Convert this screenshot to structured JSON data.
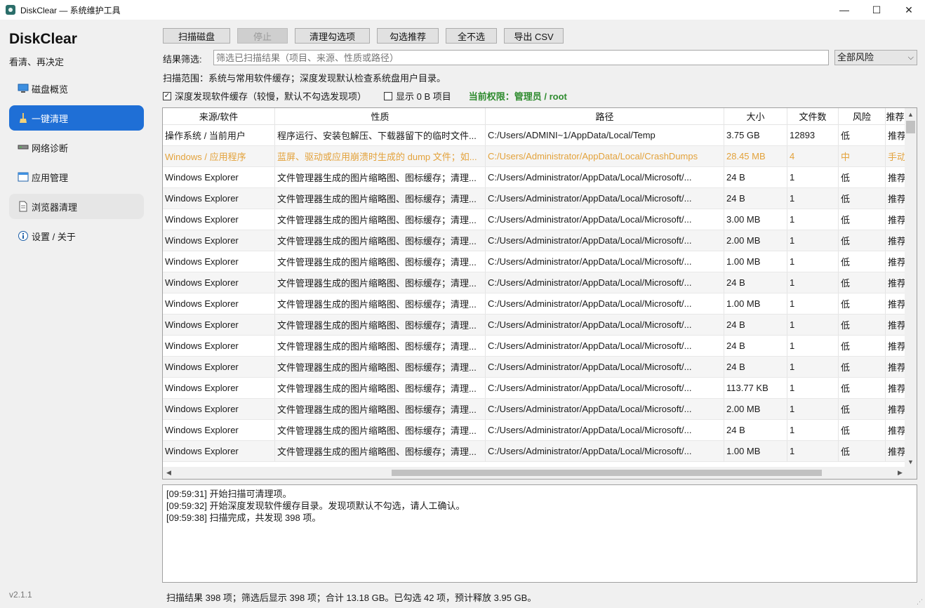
{
  "window": {
    "title": "DiskClear — 系统维护工具",
    "controls": {
      "minimize": "—",
      "maximize": "☐",
      "close": "✕"
    }
  },
  "sidebar": {
    "brand": "DiskClear",
    "tagline": "看清、再决定",
    "items": [
      {
        "label": "磁盘概览",
        "icon": "monitor-icon"
      },
      {
        "label": "一键清理",
        "icon": "broom-icon",
        "active": true
      },
      {
        "label": "网络诊断",
        "icon": "network-icon"
      },
      {
        "label": "应用管理",
        "icon": "window-icon"
      },
      {
        "label": "浏览器清理",
        "icon": "document-icon"
      },
      {
        "label": "设置 / 关于",
        "icon": "info-icon"
      }
    ],
    "version": "v2.1.1"
  },
  "toolbar": {
    "scan": "扫描磁盘",
    "stop": "停止",
    "clean_selected": "清理勾选项",
    "select_recommended": "勾选推荐",
    "select_none": "全不选",
    "export_csv": "导出 CSV"
  },
  "filter": {
    "label": "结果筛选:",
    "placeholder": "筛选已扫描结果（项目、来源、性质或路径）",
    "risk_select": "全部风险"
  },
  "scope_text": "扫描范围：系统与常用软件缓存；深度发现默认检查系统盘用户目录。",
  "options": {
    "deep_discovery": "深度发现软件缓存（较慢，默认不勾选发现项）",
    "deep_discovery_checked": true,
    "show_zero": "显示 0 B 项目",
    "show_zero_checked": false,
    "permission": "当前权限：管理员 / root"
  },
  "table": {
    "columns": [
      "来源/软件",
      "性质",
      "路径",
      "大小",
      "文件数",
      "风险",
      "推荐"
    ],
    "rows": [
      [
        "操作系统 / 当前用户",
        "程序运行、安装包解压、下载器留下的临时文件...",
        "C:/Users/ADMINI~1/AppData/Local/Temp",
        "3.75 GB",
        "12893",
        "低",
        "推荐"
      ],
      [
        "Windows / 应用程序",
        "蓝屏、驱动或应用崩溃时生成的 dump 文件；如...",
        "C:/Users/Administrator/AppData/Local/CrashDumps",
        "28.45 MB",
        "4",
        "中",
        "手动"
      ],
      [
        "Windows Explorer",
        "文件管理器生成的图片缩略图、图标缓存；清理...",
        "C:/Users/Administrator/AppData/Local/Microsoft/...",
        "24 B",
        "1",
        "低",
        "推荐"
      ],
      [
        "Windows Explorer",
        "文件管理器生成的图片缩略图、图标缓存；清理...",
        "C:/Users/Administrator/AppData/Local/Microsoft/...",
        "24 B",
        "1",
        "低",
        "推荐"
      ],
      [
        "Windows Explorer",
        "文件管理器生成的图片缩略图、图标缓存；清理...",
        "C:/Users/Administrator/AppData/Local/Microsoft/...",
        "3.00 MB",
        "1",
        "低",
        "推荐"
      ],
      [
        "Windows Explorer",
        "文件管理器生成的图片缩略图、图标缓存；清理...",
        "C:/Users/Administrator/AppData/Local/Microsoft/...",
        "2.00 MB",
        "1",
        "低",
        "推荐"
      ],
      [
        "Windows Explorer",
        "文件管理器生成的图片缩略图、图标缓存；清理...",
        "C:/Users/Administrator/AppData/Local/Microsoft/...",
        "1.00 MB",
        "1",
        "低",
        "推荐"
      ],
      [
        "Windows Explorer",
        "文件管理器生成的图片缩略图、图标缓存；清理...",
        "C:/Users/Administrator/AppData/Local/Microsoft/...",
        "24 B",
        "1",
        "低",
        "推荐"
      ],
      [
        "Windows Explorer",
        "文件管理器生成的图片缩略图、图标缓存；清理...",
        "C:/Users/Administrator/AppData/Local/Microsoft/...",
        "1.00 MB",
        "1",
        "低",
        "推荐"
      ],
      [
        "Windows Explorer",
        "文件管理器生成的图片缩略图、图标缓存；清理...",
        "C:/Users/Administrator/AppData/Local/Microsoft/...",
        "24 B",
        "1",
        "低",
        "推荐"
      ],
      [
        "Windows Explorer",
        "文件管理器生成的图片缩略图、图标缓存；清理...",
        "C:/Users/Administrator/AppData/Local/Microsoft/...",
        "24 B",
        "1",
        "低",
        "推荐"
      ],
      [
        "Windows Explorer",
        "文件管理器生成的图片缩略图、图标缓存；清理...",
        "C:/Users/Administrator/AppData/Local/Microsoft/...",
        "24 B",
        "1",
        "低",
        "推荐"
      ],
      [
        "Windows Explorer",
        "文件管理器生成的图片缩略图、图标缓存；清理...",
        "C:/Users/Administrator/AppData/Local/Microsoft/...",
        "113.77 KB",
        "1",
        "低",
        "推荐"
      ],
      [
        "Windows Explorer",
        "文件管理器生成的图片缩略图、图标缓存；清理...",
        "C:/Users/Administrator/AppData/Local/Microsoft/...",
        "2.00 MB",
        "1",
        "低",
        "推荐"
      ],
      [
        "Windows Explorer",
        "文件管理器生成的图片缩略图、图标缓存；清理...",
        "C:/Users/Administrator/AppData/Local/Microsoft/...",
        "24 B",
        "1",
        "低",
        "推荐"
      ],
      [
        "Windows Explorer",
        "文件管理器生成的图片缩略图、图标缓存；清理...",
        "C:/Users/Administrator/AppData/Local/Microsoft/...",
        "1.00 MB",
        "1",
        "低",
        "推荐"
      ]
    ],
    "warn_row_color": "#e3a23b"
  },
  "log": [
    "[09:59:31] 开始扫描可清理项。",
    "[09:59:32] 开始深度发现软件缓存目录。发现项默认不勾选，请人工确认。",
    "[09:59:38] 扫描完成，共发现 398 项。"
  ],
  "status": "扫描结果 398 项；筛选后显示 398 项；合计 13.18 GB。已勾选 42 项，预计释放 3.95 GB。",
  "colors": {
    "accent": "#1f6fd6",
    "permission": "#2e8b2e",
    "warning": "#e3a23b"
  }
}
